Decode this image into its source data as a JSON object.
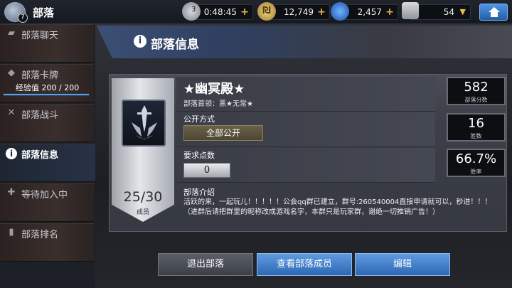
{
  "topbar": {
    "title": "部落",
    "emblem_badge": "?",
    "timer": {
      "count": "3",
      "value": "0:48:45"
    },
    "coins": "12,749",
    "gems": "2,457",
    "trophies": "54"
  },
  "sidebar": {
    "items": [
      {
        "label": "部落聊天",
        "icon": "chat-icon"
      },
      {
        "label": "部落卡牌",
        "icon": "cards-icon",
        "exp_label": "经验值 200 / 200",
        "exp_fraction": 1.0
      },
      {
        "label": "部落战斗",
        "icon": "crossed-swords-icon"
      },
      {
        "label": "部落信息",
        "icon": "info-icon",
        "active": true
      },
      {
        "label": "等待加入中",
        "icon": "plus-icon"
      },
      {
        "label": "部落排名",
        "icon": "ranking-icon"
      }
    ]
  },
  "header": {
    "title": "部落信息",
    "icon": "info-icon"
  },
  "guild": {
    "name": "★幽冥殿★",
    "leader": "部落首领：黑★无常★",
    "join_label": "公开方式",
    "join_value": "全部公开",
    "req_label": "要求点数",
    "req_value": "0",
    "intro_label": "部落介绍",
    "intro_text": "活跃的来，一起玩儿！！！！！公会qq群已建立，群号:260540004直接申请就可以，秒进！！！（进群后请把群里的昵称改成游戏名字，本群只是玩家群，谢绝一切推销广告！）",
    "members": "25/30",
    "members_label": "成员"
  },
  "stats": [
    {
      "value": "582",
      "label": "部落分数"
    },
    {
      "value": "16",
      "label": "胜数"
    },
    {
      "value": "66.7%",
      "label": "胜率"
    }
  ],
  "buttons": {
    "leave": "退出部落",
    "view_members": "查看部落成员",
    "edit": "编辑"
  },
  "colors": {
    "accent_blue": "#2d67b4",
    "gold": "#f0b94a"
  }
}
